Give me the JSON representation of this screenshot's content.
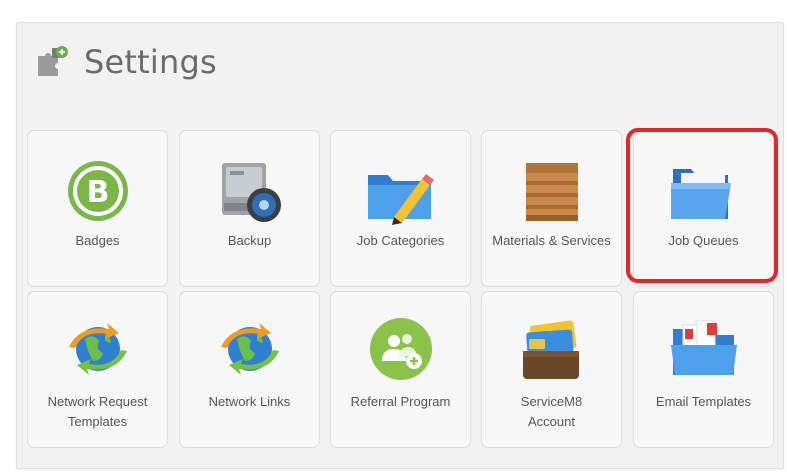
{
  "page": {
    "title": "Settings",
    "title_icon": "puzzle-piece-icon"
  },
  "tiles": [
    {
      "id": "badges",
      "label": "Badges",
      "icon": "badge-b-icon"
    },
    {
      "id": "backup",
      "label": "Backup",
      "icon": "hard-drive-backup-icon"
    },
    {
      "id": "job-categories",
      "label": "Job Categories",
      "icon": "folder-pencil-icon"
    },
    {
      "id": "materials-services",
      "label": "Materials & Services",
      "icon": "wooden-crate-icon"
    },
    {
      "id": "job-queues",
      "label": "Job Queues",
      "icon": "open-folder-icon"
    },
    {
      "id": "network-request-templates",
      "label": "Network Request\nTemplates",
      "icon": "globe-arrows-icon"
    },
    {
      "id": "network-links",
      "label": "Network Links",
      "icon": "globe-arrows-icon"
    },
    {
      "id": "referral-program",
      "label": "Referral Program",
      "icon": "referral-people-icon"
    },
    {
      "id": "servicem8-account",
      "label": "ServiceM8\nAccount",
      "icon": "wallet-card-icon"
    },
    {
      "id": "email-templates",
      "label": "Email Templates",
      "icon": "folder-documents-icon"
    }
  ],
  "colors": {
    "highlight": "#e3262b",
    "badge_green": "#7ab648",
    "referral_green": "#8bc34a",
    "folder_blue": "#3d8fd9"
  }
}
